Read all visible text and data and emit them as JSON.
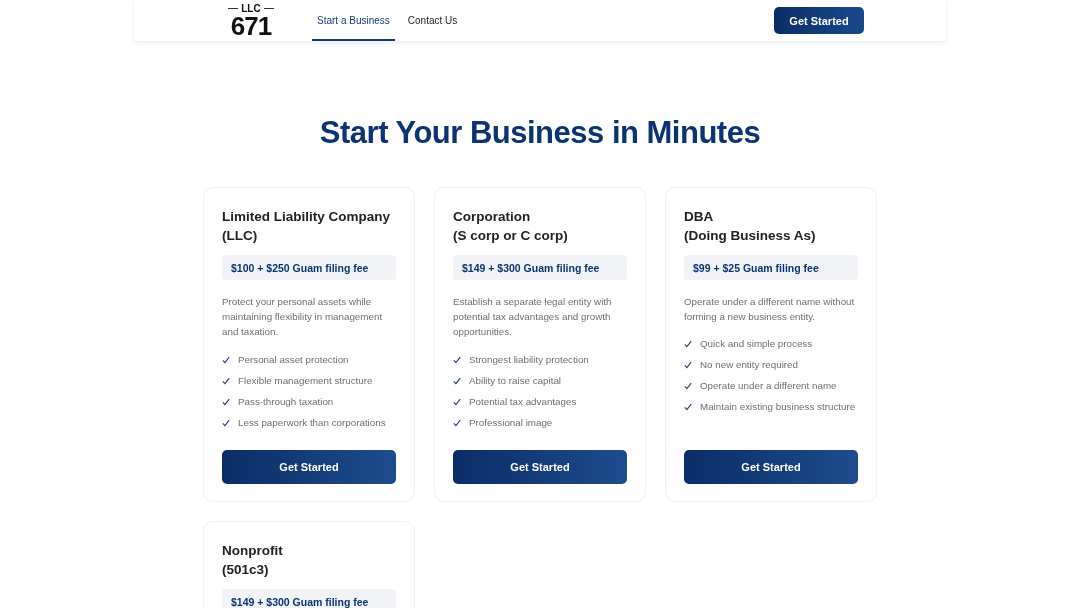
{
  "header": {
    "logo": {
      "top": "LLC",
      "main": "671"
    },
    "nav": [
      {
        "label": "Start a Business",
        "selected": true
      },
      {
        "label": "Contact Us",
        "selected": false
      }
    ],
    "cta": "Get Started"
  },
  "title": "Start Your Business in Minutes",
  "cards": [
    {
      "title_lines": [
        "Limited Liability Company",
        "(LLC)"
      ],
      "price": "$100 + $250 Guam filing fee",
      "description": "Protect your personal assets while maintaining flexibility in management and taxation.",
      "features": [
        "Personal asset protection",
        "Flexible management structure",
        "Pass-through taxation",
        "Less paperwork than corporations"
      ],
      "button": "Get Started"
    },
    {
      "title_lines": [
        "Corporation",
        "(S corp or C corp)"
      ],
      "price": "$149 + $300 Guam filing fee",
      "description": "Establish a separate legal entity with potential tax advantages and growth opportunities.",
      "features": [
        "Strongest liability protection",
        "Ability to raise capital",
        "Potential tax advantages",
        "Professional image"
      ],
      "button": "Get Started"
    },
    {
      "title_lines": [
        "DBA",
        "(Doing Business As)"
      ],
      "price": "$99 + $25 Guam filing fee",
      "description": "Operate under a different name without forming a new business entity.",
      "features": [
        "Quick and simple process",
        "No new entity required",
        "Operate under a different name",
        "Maintain existing business structure"
      ],
      "button": "Get Started"
    },
    {
      "title_lines": [
        "Nonprofit",
        "(501c3)"
      ],
      "price": "$149 + $300 Guam filing fee"
    }
  ]
}
